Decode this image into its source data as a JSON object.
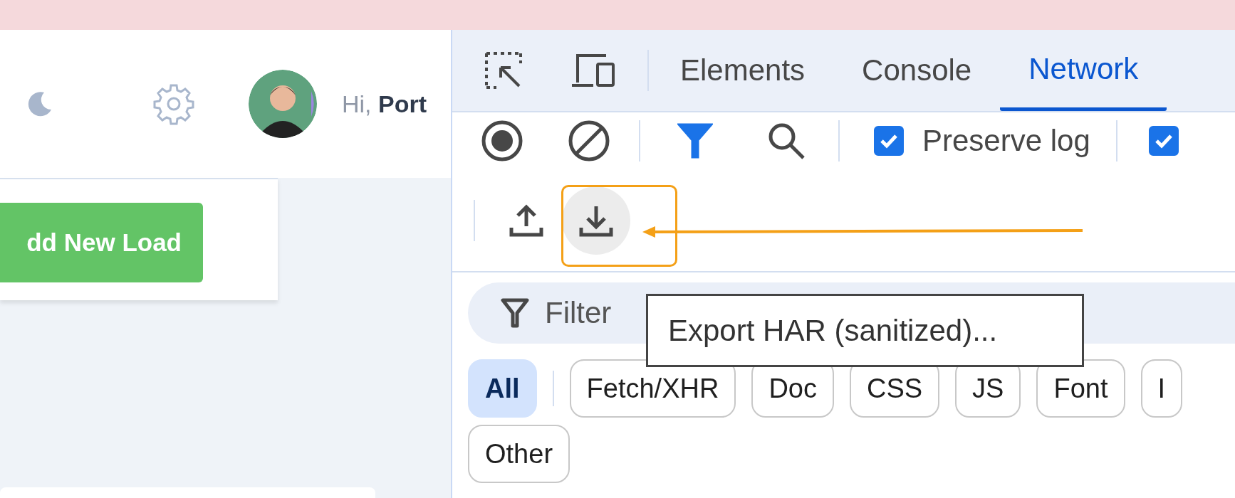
{
  "app": {
    "greeting": "Hi, **Port**",
    "add_button": "dd New Load"
  },
  "devtools": {
    "tabs": [
      {
        "label": "Elements",
        "selected": false
      },
      {
        "label": "Console",
        "selected": false
      },
      {
        "label": "Network",
        "selected": true
      }
    ],
    "filter_on": true,
    "checkboxes": [
      {
        "label": "Preserve log",
        "checked": true
      },
      {
        "checked": true
      }
    ],
    "export_hovered": true,
    "filter": {
      "placeholder": "Filter"
    },
    "tooltip": "Export HAR (sanitized)...",
    "type_filter_rows": [
      [
        {
          "label": "All",
          "selected": true
        },
        {
          "label": "Fetch/XHR",
          "selected": false
        },
        {
          "label": "Doc",
          "selected": false
        },
        {
          "label": "CSS",
          "selected": false
        },
        {
          "label": "JS",
          "selected": false
        },
        {
          "label": "Font",
          "selected": false
        },
        {
          "label": "I",
          "selected": false
        }
      ],
      [
        {
          "label": "Other",
          "selected": false
        }
      ]
    ]
  }
}
